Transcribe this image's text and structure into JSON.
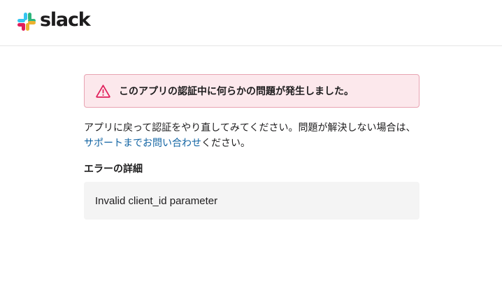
{
  "header": {
    "logo_text": "slack",
    "logo_icon": "slack-logo-icon",
    "brand_colors": [
      "#36c5f0",
      "#2eb67d",
      "#ecb22e",
      "#e01e5a"
    ]
  },
  "alert": {
    "icon": "warning-triangle-icon",
    "icon_color": "#e01e5a",
    "message": "このアプリの認証中に何らかの問題が発生しました。"
  },
  "description": {
    "text_before": "アプリに戻って認証をやり直してみてください。問題が解決しない場合は、",
    "link_text": "サポートまでお問い合わせ",
    "text_after": "ください。"
  },
  "error_details": {
    "heading": "エラーの詳細",
    "message": "Invalid client_id parameter"
  }
}
